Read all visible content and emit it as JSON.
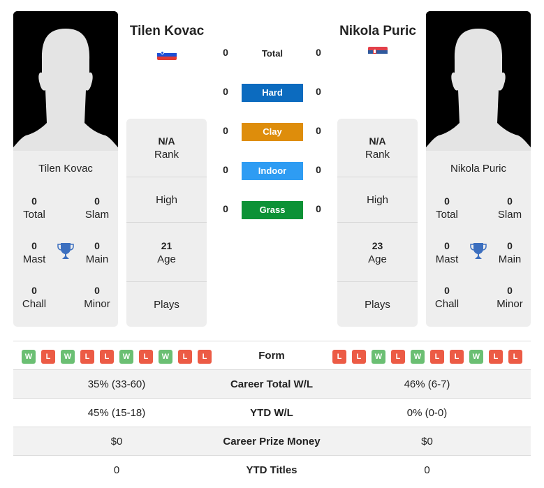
{
  "player1": {
    "name": "Tilen Kovac",
    "flag": "slovenia-flag",
    "titles": {
      "total": {
        "value": "0",
        "label": "Total"
      },
      "slam": {
        "value": "0",
        "label": "Slam"
      },
      "mast": {
        "value": "0",
        "label": "Mast"
      },
      "main": {
        "value": "0",
        "label": "Main"
      },
      "chall": {
        "value": "0",
        "label": "Chall"
      },
      "minor": {
        "value": "0",
        "label": "Minor"
      }
    },
    "info": {
      "rank": {
        "value": "N/A",
        "label": "Rank"
      },
      "high": {
        "label": "High"
      },
      "age": {
        "value": "21",
        "label": "Age"
      },
      "plays": {
        "label": "Plays"
      }
    },
    "form": [
      "W",
      "L",
      "W",
      "L",
      "L",
      "W",
      "L",
      "W",
      "L",
      "L"
    ]
  },
  "player2": {
    "name": "Nikola Puric",
    "flag": "serbia-flag",
    "titles": {
      "total": {
        "value": "0",
        "label": "Total"
      },
      "slam": {
        "value": "0",
        "label": "Slam"
      },
      "mast": {
        "value": "0",
        "label": "Mast"
      },
      "main": {
        "value": "0",
        "label": "Main"
      },
      "chall": {
        "value": "0",
        "label": "Chall"
      },
      "minor": {
        "value": "0",
        "label": "Minor"
      }
    },
    "info": {
      "rank": {
        "value": "N/A",
        "label": "Rank"
      },
      "high": {
        "label": "High"
      },
      "age": {
        "value": "23",
        "label": "Age"
      },
      "plays": {
        "label": "Plays"
      }
    },
    "form": [
      "L",
      "L",
      "W",
      "L",
      "W",
      "L",
      "L",
      "W",
      "L",
      "L"
    ]
  },
  "h2h": {
    "total": {
      "label": "Total",
      "p1": "0",
      "p2": "0"
    },
    "surfaces": [
      {
        "label": "Hard",
        "p1": "0",
        "p2": "0",
        "color": "#0c6bbf"
      },
      {
        "label": "Clay",
        "p1": "0",
        "p2": "0",
        "color": "#de8d0b"
      },
      {
        "label": "Indoor",
        "p1": "0",
        "p2": "0",
        "color": "#2e9cf3"
      },
      {
        "label": "Grass",
        "p1": "0",
        "p2": "0",
        "color": "#0c9236"
      }
    ]
  },
  "comparison": {
    "form_label": "Form",
    "rows": [
      {
        "label": "Career Total W/L",
        "p1": "35% (33-60)",
        "p2": "46% (6-7)"
      },
      {
        "label": "YTD W/L",
        "p1": "45% (15-18)",
        "p2": "0% (0-0)"
      },
      {
        "label": "Career Prize Money",
        "p1": "$0",
        "p2": "$0"
      },
      {
        "label": "YTD Titles",
        "p1": "0",
        "p2": "0"
      }
    ]
  },
  "colors": {
    "win": "#6bbf73",
    "loss": "#ec5b45",
    "trophy": "#3c6fbf"
  }
}
